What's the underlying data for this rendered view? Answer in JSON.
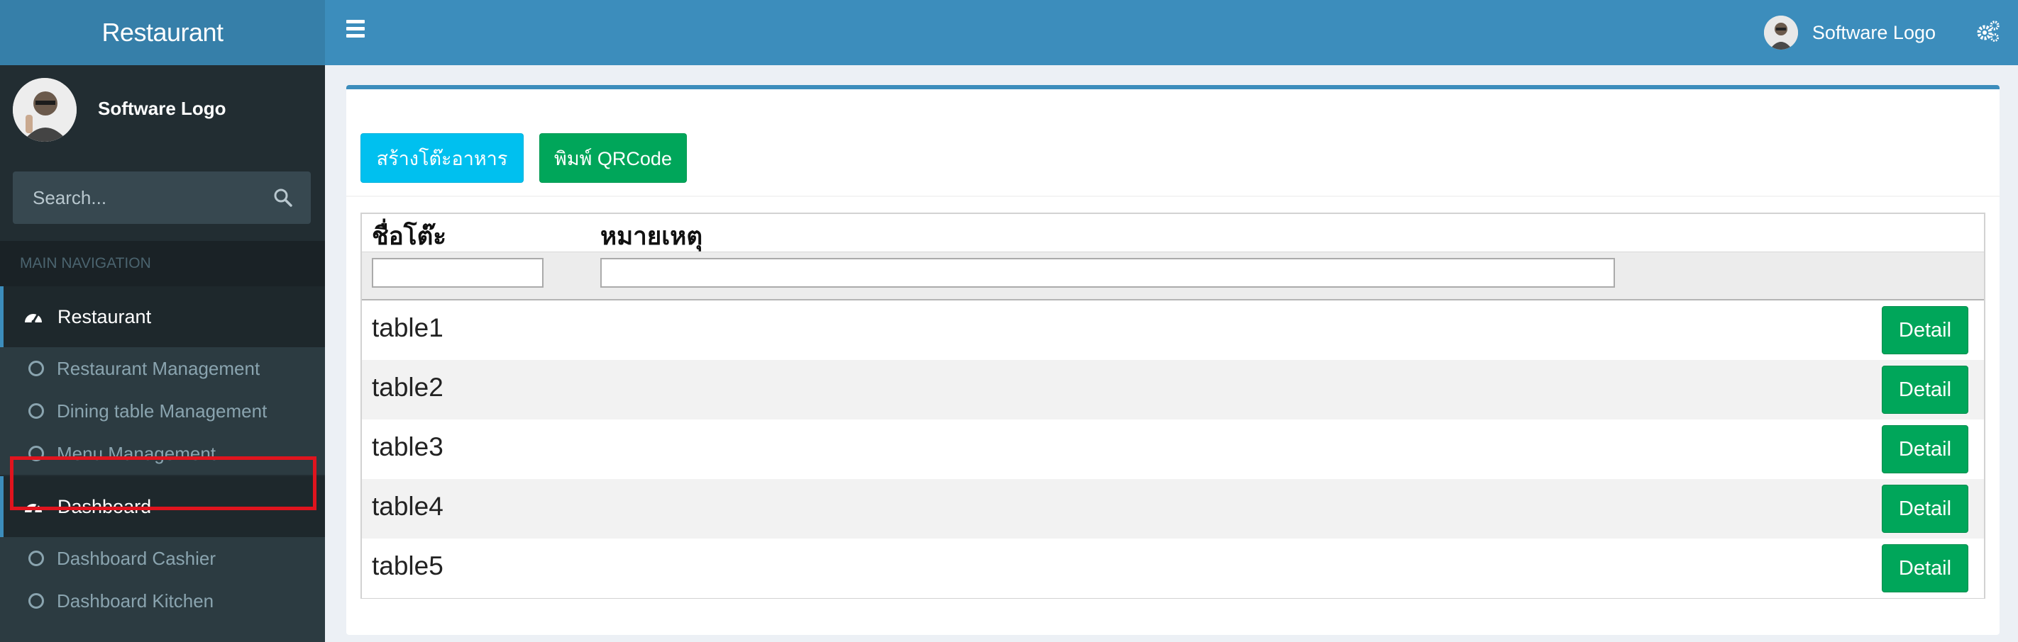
{
  "app": {
    "title": "Restaurant"
  },
  "navbar": {
    "user_name": "Software Logo"
  },
  "sidebar": {
    "user_name": "Software Logo",
    "search_placeholder": "Search...",
    "header": "MAIN NAVIGATION",
    "sections": [
      {
        "label": "Restaurant",
        "items": [
          "Restaurant Management",
          "Dining table Management",
          "Menu Management"
        ]
      },
      {
        "label": "Dashboard",
        "items": [
          "Dashboard Cashier",
          "Dashboard Kitchen"
        ]
      }
    ]
  },
  "toolbar": {
    "create_label": "สร้างโต๊ะอาหาร",
    "print_label": "พิมพ์ QRCode"
  },
  "grid": {
    "columns": [
      "ชื่อโต๊ะ",
      "หมายเหตุ"
    ],
    "rows": [
      {
        "name": "table1",
        "action": "Detail"
      },
      {
        "name": "table2",
        "action": "Detail"
      },
      {
        "name": "table3",
        "action": "Detail"
      },
      {
        "name": "table4",
        "action": "Detail"
      },
      {
        "name": "table5",
        "action": "Detail"
      }
    ]
  },
  "colors": {
    "navbar": "#3c8dbc",
    "logo": "#367fa9",
    "sidebar": "#222d32",
    "info": "#00c0ef",
    "success": "#00a65a",
    "highlight": "#e0141e"
  }
}
